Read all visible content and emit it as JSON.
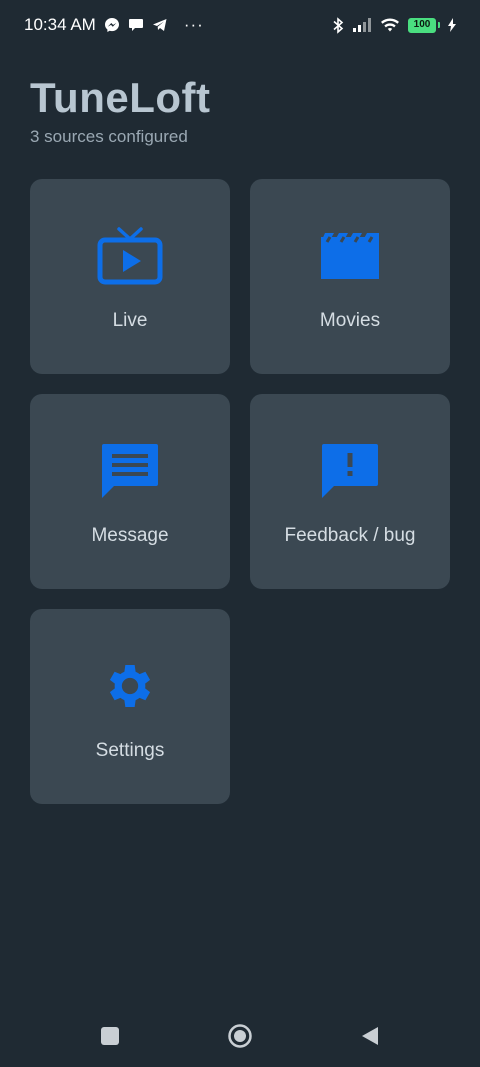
{
  "status_bar": {
    "time": "10:34 AM",
    "more": "···",
    "battery_level": "100",
    "left_icons": [
      "messenger-icon",
      "chat-bubble-icon",
      "telegram-icon"
    ],
    "right_icons": [
      "bluetooth-icon",
      "signal-icon",
      "wifi-icon",
      "battery-icon",
      "charging-icon"
    ]
  },
  "header": {
    "title": "TuneLoft",
    "subtitle": "3 sources configured"
  },
  "tiles": [
    {
      "label": "Live",
      "icon": "tv-icon"
    },
    {
      "label": "Movies",
      "icon": "clapperboard-icon"
    },
    {
      "label": "Message",
      "icon": "message-icon"
    },
    {
      "label": "Feedback / bug",
      "icon": "feedback-icon"
    },
    {
      "label": "Settings",
      "icon": "gear-icon"
    }
  ],
  "nav_bar": {
    "buttons": [
      "recents-square-icon",
      "home-circle-icon",
      "back-triangle-icon"
    ]
  },
  "colors": {
    "background": "#1f2a33",
    "tile": "#3b4852",
    "accent": "#0d6ee8",
    "title": "#b8c6d1"
  }
}
